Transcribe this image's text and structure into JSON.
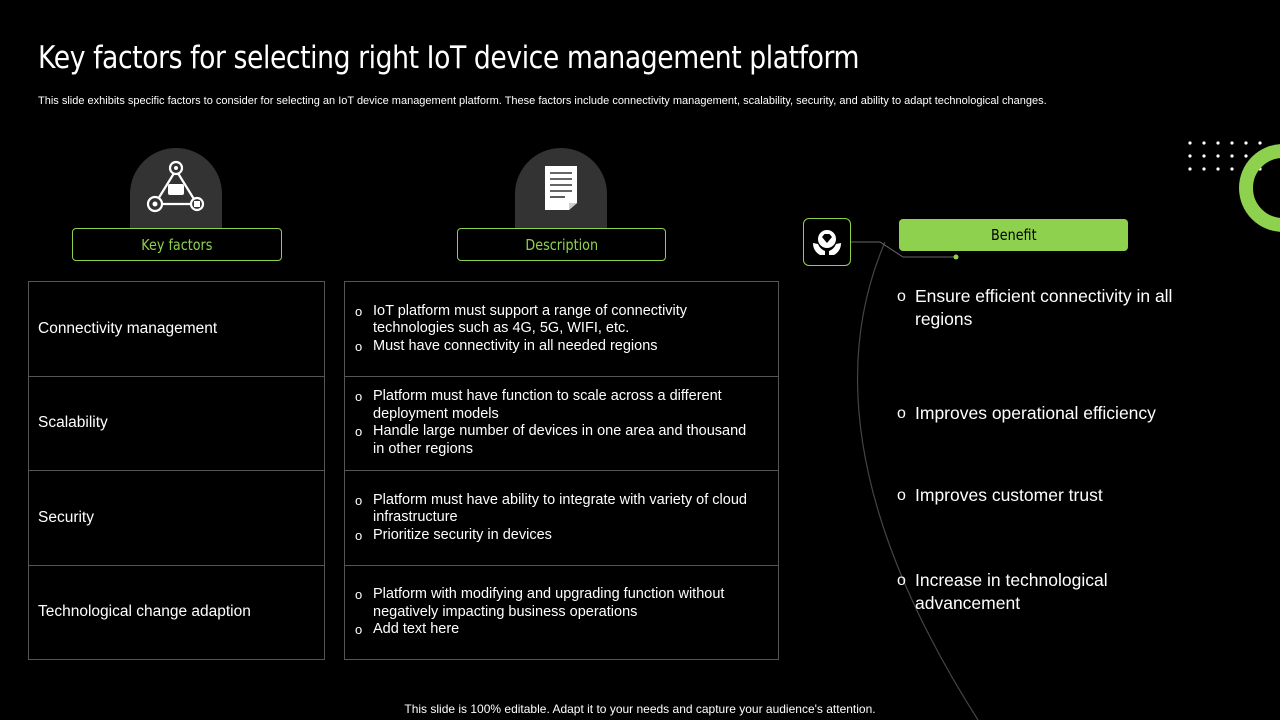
{
  "slide": {
    "title": "Key factors for selecting right IoT device management platform",
    "subtitle": "This slide exhibits specific factors to consider for selecting an IoT device management platform. These factors include connectivity management, scalability, security, and ability to  adapt technological changes.",
    "footer": "This slide is 100% editable. Adapt it to your needs and capture your audience's attention."
  },
  "headers": {
    "key_factors": "Key factors",
    "description": "Description",
    "benefit": "Benefit"
  },
  "rows": [
    {
      "factor": "Connectivity management",
      "bullets": [
        "IoT platform must support a range of connectivity technologies such as 4G, 5G, WIFI, etc.",
        "Must have connectivity in all needed regions"
      ]
    },
    {
      "factor": "Scalability",
      "bullets": [
        "Platform must have function to scale across a different deployment models",
        "Handle large number of devices in one area and  thousand in other regions"
      ]
    },
    {
      "factor": "Security",
      "bullets": [
        "Platform must have ability to integrate with variety of cloud infrastructure",
        "Prioritize security in devices"
      ]
    },
    {
      "factor": "Technological change adaption",
      "bullets": [
        "Platform with  modifying and upgrading function without negatively  impacting business operations",
        "Add text here"
      ]
    }
  ],
  "benefits": [
    "Ensure efficient connectivity in all regions",
    "Improves operational efficiency",
    "Improves customer trust",
    "Increase in technological advancement"
  ],
  "colors": {
    "accent": "#8ed14e",
    "background": "#000000",
    "icon_bg": "#333333"
  },
  "icons": [
    "network-triangle-icon",
    "document-icon",
    "hands-diamond-icon"
  ]
}
